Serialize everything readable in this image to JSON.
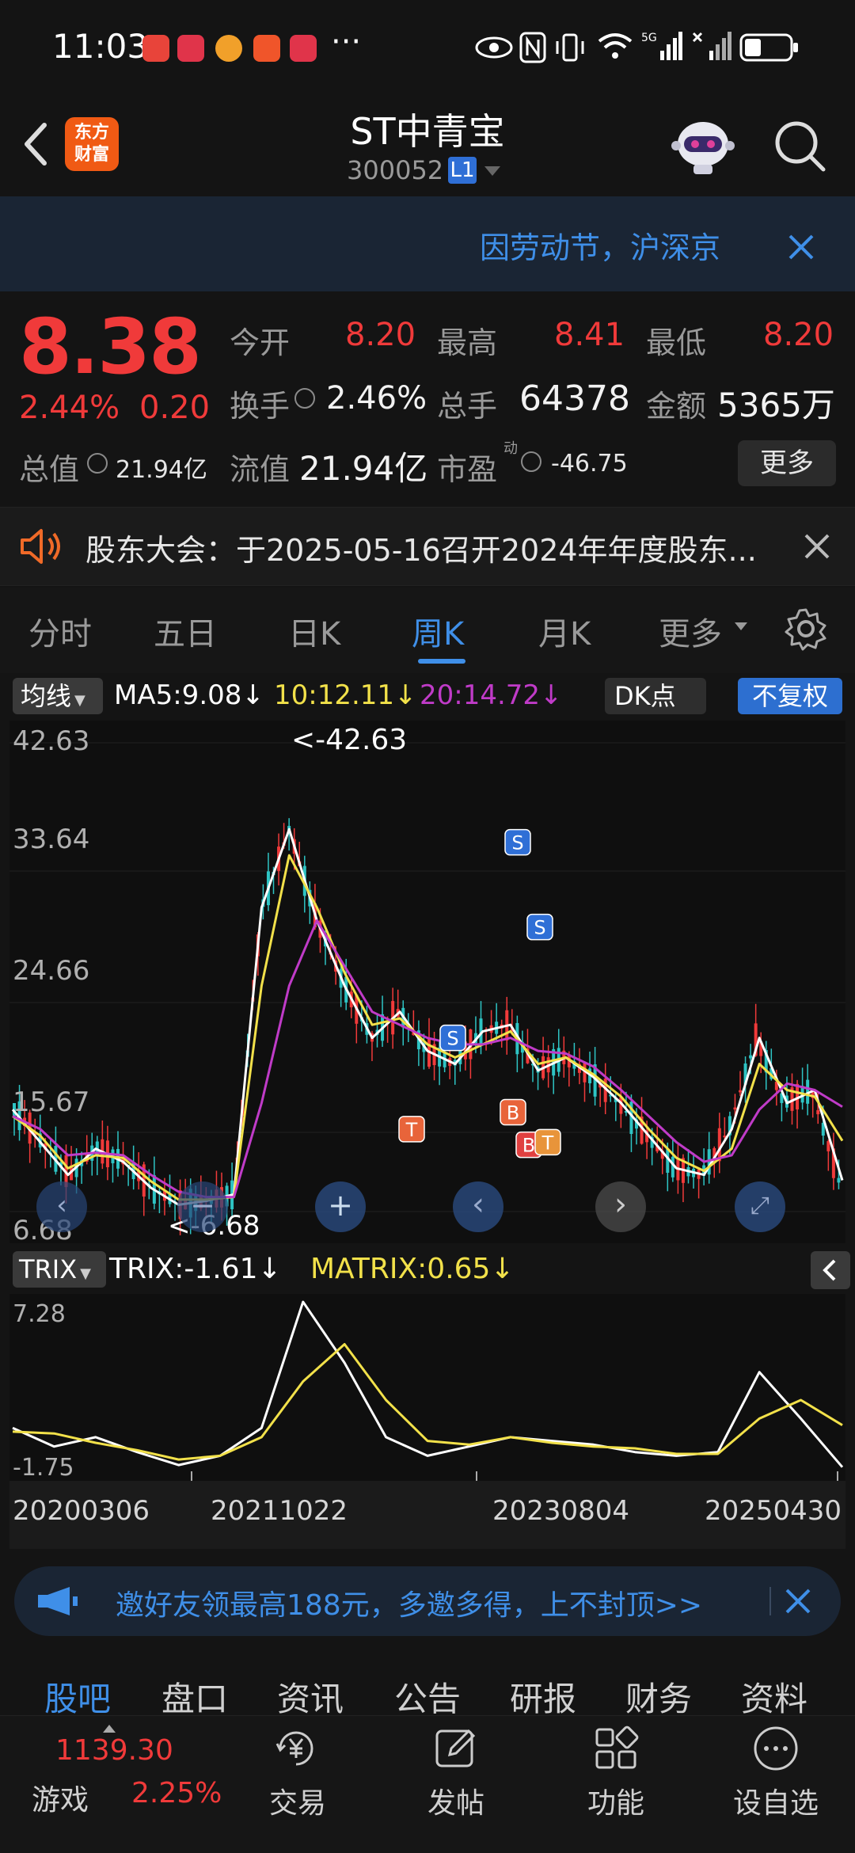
{
  "status_bar": {
    "time": "11:03",
    "more": "···"
  },
  "header": {
    "brand": "东方\n财富",
    "stock_name": "ST中青宝",
    "stock_code": "300052",
    "level": "L1"
  },
  "banner": {
    "text": "因劳动节，沪深京"
  },
  "quote": {
    "price": "8.38",
    "change_pct": "2.44%",
    "change_amt": "0.20",
    "open_label": "今开",
    "open": "8.20",
    "high_label": "最高",
    "high": "8.41",
    "low_label": "最低",
    "low": "8.20",
    "turnover_label": "换手",
    "turnover": "2.46%",
    "volume_label": "总手",
    "volume": "64378",
    "amount_label": "金额",
    "amount": "5365万",
    "total_mv_label": "总值",
    "total_mv": "21.94亿",
    "float_mv_label": "流值",
    "float_mv": "21.94亿",
    "pe_label": "市盈",
    "pe_sup": "动",
    "pe": "-46.75",
    "more": "更多"
  },
  "notice": {
    "text": "股东大会：于2025-05-16召开2024年年度股东..."
  },
  "period_tabs": [
    "分时",
    "五日",
    "日K",
    "周K",
    "月K",
    "更多"
  ],
  "active_period": "周K",
  "indicator": {
    "ma_select": "均线",
    "ma5": "MA5:9.08↓",
    "ma10": "10:12.11↓",
    "ma20": "20:14.72↓",
    "dk": "DK点",
    "adjust": "不复权"
  },
  "colors": {
    "up": "#f03a3a",
    "down": "#2ec4c4",
    "ma5": "#ffffff",
    "ma10": "#f2e14a",
    "ma20": "#c03bc8",
    "accent": "#3f8fe8"
  },
  "chart_data": {
    "type": "line",
    "y_ticks": [
      "42.63",
      "33.64",
      "24.66",
      "15.67",
      "6.68"
    ],
    "peak_label": "<-42.63",
    "low_label": "<-6.68",
    "ylim": [
      6.68,
      42.63
    ],
    "x_ticks": [
      "20200306",
      "20211022",
      "20230804",
      "20250430"
    ],
    "series": [
      {
        "name": "MA5",
        "values": [
          14.5,
          12.0,
          9.5,
          11.5,
          10.5,
          8.5,
          7.2,
          7.5,
          8.0,
          30.0,
          36.0,
          29.0,
          24.0,
          20.0,
          22.0,
          19.0,
          18.0,
          20.5,
          21.0,
          17.5,
          18.5,
          17.0,
          15.0,
          12.5,
          10.0,
          9.5,
          13.0,
          20.0,
          15.0,
          16.0,
          9.08
        ]
      },
      {
        "name": "10",
        "values": [
          14.0,
          12.5,
          10.0,
          11.0,
          10.8,
          9.0,
          7.6,
          7.6,
          7.8,
          24.0,
          34.0,
          30.0,
          25.0,
          21.0,
          21.5,
          19.5,
          18.5,
          19.5,
          20.5,
          18.0,
          18.5,
          17.2,
          15.5,
          13.0,
          10.8,
          9.8,
          11.5,
          18.0,
          16.0,
          15.5,
          12.11
        ]
      },
      {
        "name": "20",
        "values": [
          14.0,
          13.0,
          11.0,
          11.2,
          11.0,
          9.5,
          8.2,
          7.8,
          7.8,
          15.0,
          24.0,
          29.0,
          25.5,
          22.0,
          21.0,
          20.0,
          19.5,
          19.5,
          20.0,
          19.0,
          18.8,
          17.8,
          16.0,
          14.0,
          12.0,
          10.5,
          11.0,
          14.5,
          16.5,
          16.0,
          14.72
        ]
      }
    ],
    "markers": [
      "S",
      "S",
      "S",
      "B",
      "B",
      "T",
      "T"
    ]
  },
  "trix": {
    "select": "TRIX",
    "trix_text": "TRIX:-1.61↓",
    "matrix_text": "MATRIX:0.65↓",
    "y_top": "7.28",
    "y_bottom": "-1.75",
    "trix_values": [
      0.5,
      -0.5,
      0.0,
      -0.8,
      -1.5,
      -1.0,
      0.5,
      7.28,
      4.0,
      0.0,
      -1.0,
      -0.5,
      0.0,
      -0.2,
      -0.4,
      -0.8,
      -1.0,
      -0.8,
      3.5,
      1.0,
      -1.61
    ],
    "matrix_values": [
      0.3,
      0.2,
      -0.3,
      -0.7,
      -1.2,
      -1.0,
      0.0,
      3.0,
      5.0,
      2.0,
      -0.2,
      -0.4,
      0.0,
      -0.3,
      -0.5,
      -0.6,
      -0.9,
      -0.9,
      1.0,
      2.0,
      0.65
    ]
  },
  "invite": {
    "text": "邀好友领最高188元，多邀多得，上不封顶>>"
  },
  "section_tabs": [
    "股吧",
    "盘口",
    "资讯",
    "公告",
    "研报",
    "财务",
    "资料"
  ],
  "active_section": "股吧",
  "bottom": {
    "game_index": "1139.30",
    "game_label": "游戏",
    "game_pct": "2.25%",
    "items": [
      "交易",
      "发帖",
      "功能",
      "设自选"
    ]
  }
}
